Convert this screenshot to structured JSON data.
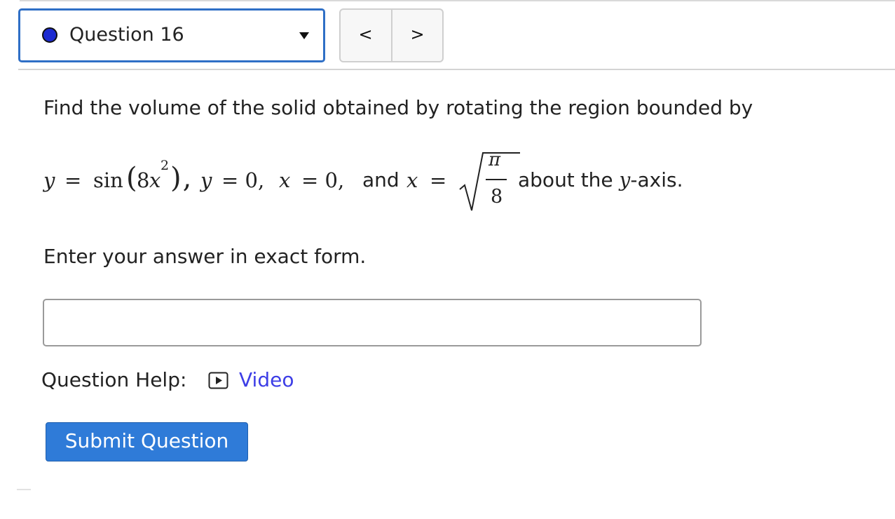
{
  "question_nav": {
    "selected_question": "Question 16",
    "prev_label": "<",
    "next_label": ">",
    "status_color": "#1d2bd1"
  },
  "question": {
    "prompt": "Find the volume of the solid obtained by rotating the region bounded by",
    "math": {
      "eq1_lhs": "y",
      "eq1_eq": "=",
      "eq1_func": "sin",
      "eq1_open": "(",
      "eq1_coef": "8",
      "eq1_var": "x",
      "eq1_exp": "2",
      "eq1_close": "),",
      "eq2_lhs": "y",
      "eq2_rhs": "= 0,",
      "eq3_lhs": "x",
      "eq3_rhs": "= 0,",
      "and_text": "and",
      "eq4_lhs": "x",
      "eq4_eq": "=",
      "frac_num": "π",
      "frac_den": "8",
      "tail_prefix": "about the",
      "tail_var": "y",
      "tail_suffix": "-axis."
    },
    "instruction": "Enter your answer in exact form.",
    "answer_value": "",
    "help_label": "Question Help:",
    "video_label": "Video",
    "submit_label": "Submit Question"
  }
}
